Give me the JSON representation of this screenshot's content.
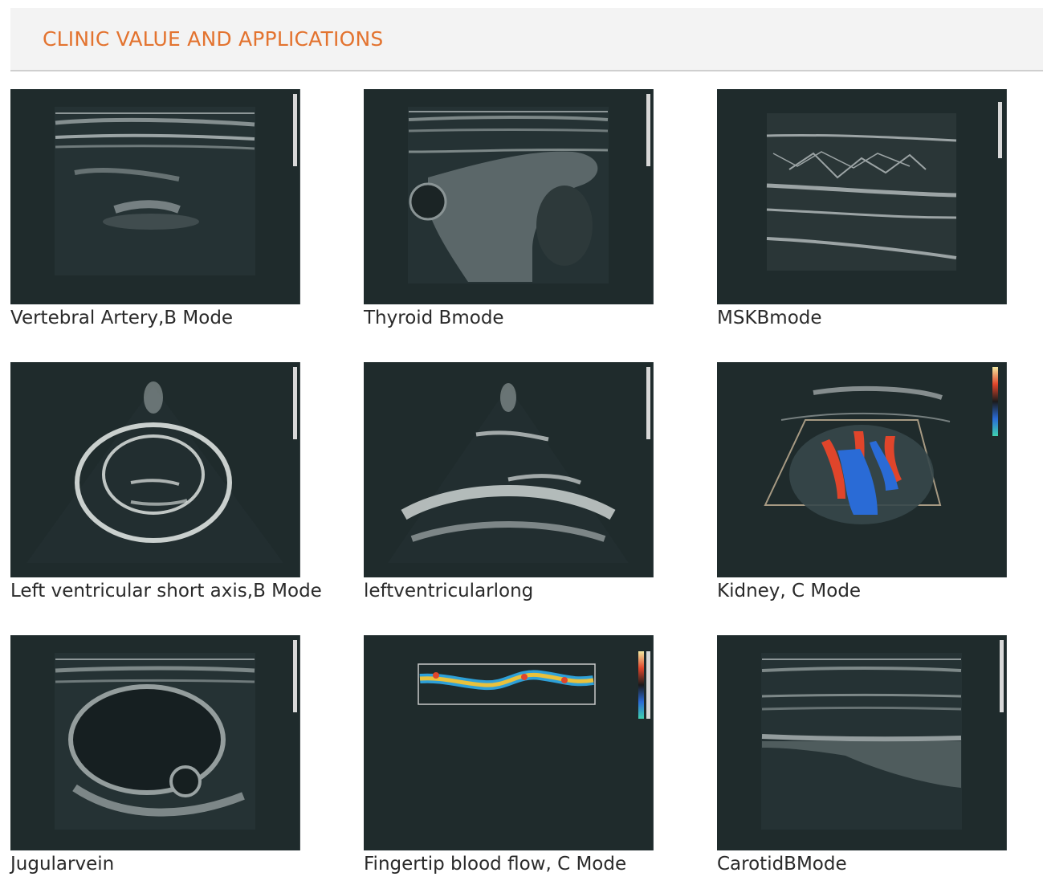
{
  "section": {
    "title": "CLINIC VALUE AND APPLICATIONS"
  },
  "gallery": [
    {
      "id": "vertebral",
      "caption": "Vertebral Artery,B Mode"
    },
    {
      "id": "thyroid",
      "caption": "Thyroid Bmode"
    },
    {
      "id": "msk",
      "caption": "MSKBmode"
    },
    {
      "id": "lv-short",
      "caption": "Left ventricular short axis,B Mode"
    },
    {
      "id": "lv-long",
      "caption": "leftventricularlong"
    },
    {
      "id": "kidney",
      "caption": "Kidney, C Mode"
    },
    {
      "id": "jugular",
      "caption": "Jugularvein"
    },
    {
      "id": "fingertip",
      "caption": "Fingertip blood flow, C Mode"
    },
    {
      "id": "carotid",
      "caption": "CarotidBMode"
    }
  ]
}
